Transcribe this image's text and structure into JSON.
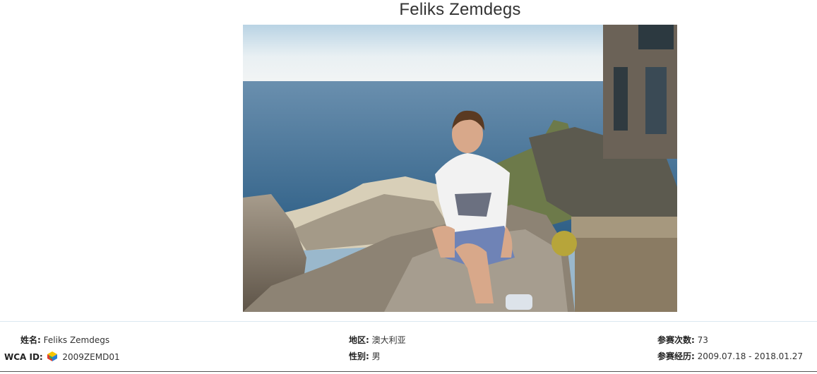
{
  "profile": {
    "title": "Feliks Zemdegs",
    "photo_icon": "person-photo"
  },
  "details": {
    "name_label": "姓名:",
    "name_value": "Feliks Zemdegs",
    "wca_label": "WCA ID:",
    "wca_icon": "wca-cube-icon",
    "wca_value": "2009ZEMD01",
    "region_label": "地区:",
    "region_value": "澳大利亚",
    "gender_label": "性别:",
    "gender_value": "男",
    "competitions_label": "参赛次数:",
    "competitions_value": "73",
    "history_label": "参赛经历:",
    "history_value": "2009.07.18 - 2018.01.27"
  }
}
